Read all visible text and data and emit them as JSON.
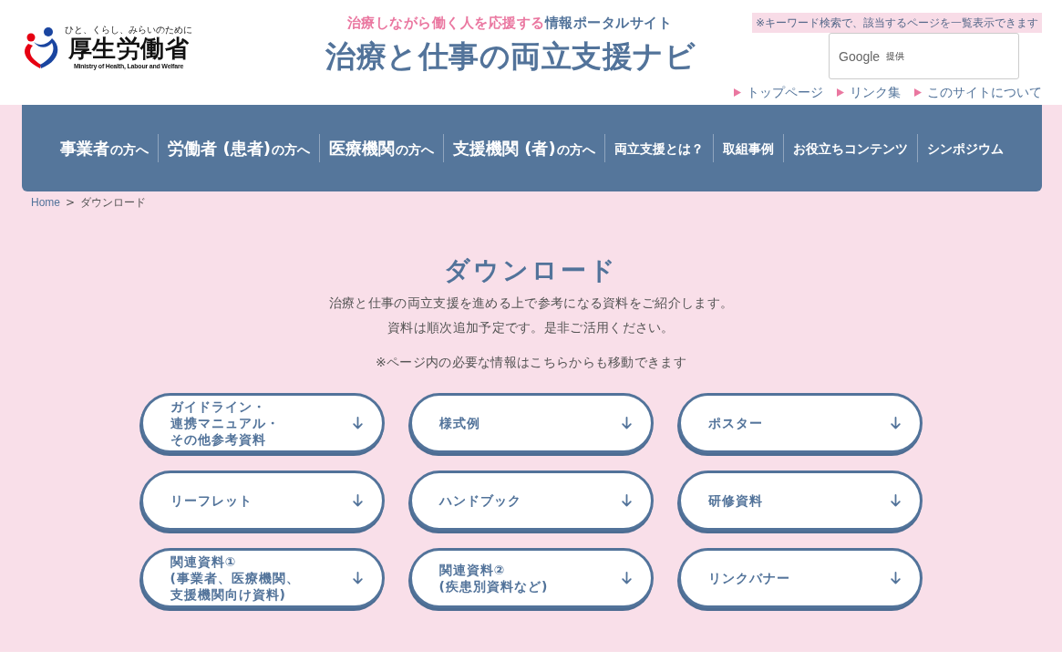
{
  "header": {
    "logo": {
      "slogan": "ひと、くらし、みらいのために",
      "name": "厚生労働省",
      "english_name": "Ministry of Health, Labour and Welfare"
    },
    "tagline_accent": "治療しながら働く人を応援する",
    "tagline": "情報ポータルサイト",
    "site_title": "治療と仕事の両立支援ナビ",
    "search": {
      "note": "※キーワード検索で、該当するページを一覧表示できます",
      "provider": "Google",
      "provider_note": "提供"
    },
    "links": [
      "トップページ",
      "リンク集",
      "このサイトについて"
    ]
  },
  "nav": [
    {
      "kind": "audience",
      "label": "事業者",
      "suffix": "の方へ"
    },
    {
      "kind": "audience",
      "label": "労働者 (患者)",
      "suffix": "の方へ"
    },
    {
      "kind": "audience",
      "label": "医療機関",
      "suffix": "の方へ"
    },
    {
      "kind": "audience",
      "label": "支援機関 (者)",
      "suffix": "の方へ"
    },
    {
      "kind": "topic",
      "label": "両立支援とは？"
    },
    {
      "kind": "topic",
      "label": "取組事例"
    },
    {
      "kind": "topic",
      "label": "お役立ちコンテンツ"
    },
    {
      "kind": "topic",
      "label": "シンポジウム"
    }
  ],
  "breadcrumb": {
    "items": [
      "Home",
      "ダウンロード"
    ],
    "separator": ">"
  },
  "page": {
    "title": "ダウンロード",
    "intro": [
      "治療と仕事の両立支援を進める上で参考になる資料をご紹介します。",
      "資料は順次追加予定です。是非ご活用ください。"
    ],
    "note": "※ページ内の必要な情報はこちらからも移動できます"
  },
  "downloads": [
    {
      "lines": [
        "ガイドライン・",
        "連携マニュアル・",
        "その他参考資料"
      ]
    },
    {
      "lines": [
        "様式例"
      ]
    },
    {
      "lines": [
        "ポスター"
      ]
    },
    {
      "lines": [
        "リーフレット"
      ]
    },
    {
      "lines": [
        "ハンドブック"
      ]
    },
    {
      "lines": [
        "研修資料"
      ]
    },
    {
      "lines": [
        "関連資料①",
        "(事業者、医療機関、",
        "支援機関向け資料)"
      ]
    },
    {
      "lines": [
        "関連資料②",
        "(疾患別資料など)"
      ]
    },
    {
      "lines": [
        "リンクバナー"
      ]
    }
  ]
}
